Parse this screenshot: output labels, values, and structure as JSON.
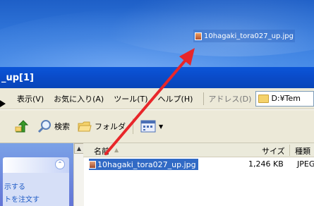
{
  "desktop": {
    "file_label": "10hagaki_tora027_up.jpg"
  },
  "window": {
    "title": "_up[1]"
  },
  "menu": {
    "items": [
      "表示(V)",
      "お気に入り(A)",
      "ツール(T)",
      "ヘルプ(H)"
    ],
    "address_label": "アドレス(D)",
    "address_value": "D:¥Tem"
  },
  "toolbar": {
    "search_label": "検索",
    "folders_label": "フォルダ"
  },
  "tasks": {
    "items": [
      "示する",
      "トを注文す"
    ]
  },
  "list": {
    "columns": {
      "name": "名前",
      "size": "サイズ",
      "type": "種類"
    },
    "rows": [
      {
        "name": "10hagaki_tora027_up.jpg",
        "size": "1,246 KB",
        "type": "JPEG"
      }
    ]
  },
  "colors": {
    "title_bar": "#0a4bc8",
    "selection": "#316ac5",
    "annotation_arrow": "#e8262a"
  }
}
